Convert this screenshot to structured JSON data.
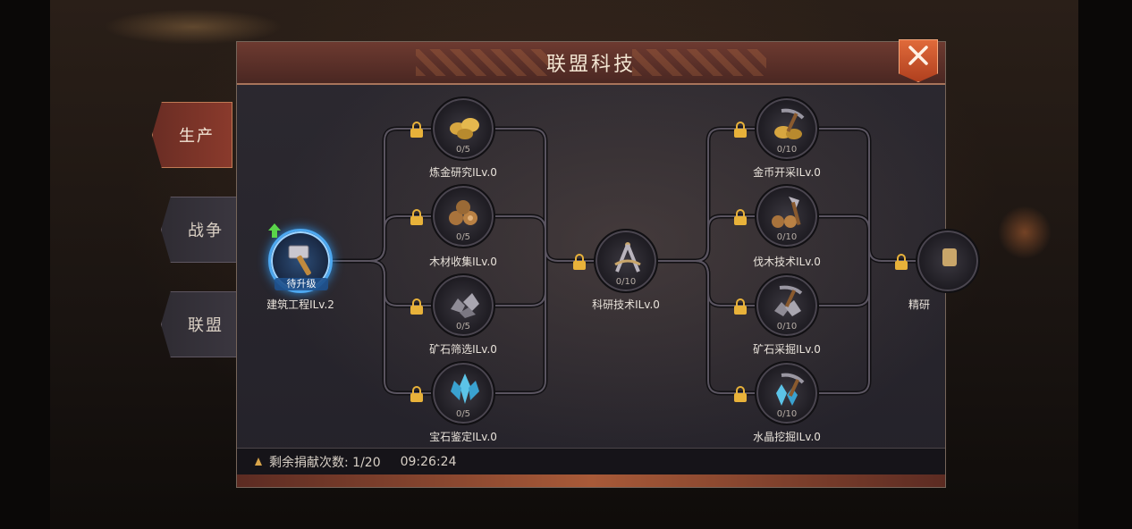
{
  "title": "联盟科技",
  "side_tabs": [
    {
      "label": "生产",
      "active": true
    },
    {
      "label": "战争",
      "active": false
    },
    {
      "label": "联盟",
      "active": false
    }
  ],
  "start_node": {
    "badge": "待升级",
    "label": "建筑工程ⅠLv.2",
    "icon": "hammer-icon",
    "upgrade_available": true
  },
  "column1": [
    {
      "label": "炼金研究ⅠLv.0",
      "progress": "0/5",
      "icon": "gold-nuggets-icon",
      "locked": true
    },
    {
      "label": "木材收集ⅠLv.0",
      "progress": "0/5",
      "icon": "logs-icon",
      "locked": true
    },
    {
      "label": "矿石筛选ⅠLv.0",
      "progress": "0/5",
      "icon": "ore-icon",
      "locked": true
    },
    {
      "label": "宝石鉴定ⅠLv.0",
      "progress": "0/5",
      "icon": "crystal-icon",
      "locked": true
    }
  ],
  "center_node": {
    "label": "科研技术ⅠLv.0",
    "progress": "0/10",
    "icon": "compass-icon",
    "locked": true
  },
  "column2": [
    {
      "label": "金币开采ⅠLv.0",
      "progress": "0/10",
      "icon": "gold-pickaxe-icon",
      "locked": true
    },
    {
      "label": "伐木技术ⅠLv.0",
      "progress": "0/10",
      "icon": "axe-logs-icon",
      "locked": true
    },
    {
      "label": "矿石采掘ⅠLv.0",
      "progress": "0/10",
      "icon": "ore-pickaxe-icon",
      "locked": true
    },
    {
      "label": "水晶挖掘ⅠLv.0",
      "progress": "0/10",
      "icon": "crystal-pickaxe-icon",
      "locked": true
    }
  ],
  "partial_node": {
    "label": "精研",
    "icon": "partial-tech-icon",
    "locked": true
  },
  "footer": {
    "donations_label": "剩余捐献次数: 1/20",
    "timer": "09:26:24"
  },
  "colors": {
    "accent_active": "#4da8f0",
    "title_bar": "#6d3a30",
    "close_button": "#e06a3a",
    "lock": "#e8b23a"
  }
}
